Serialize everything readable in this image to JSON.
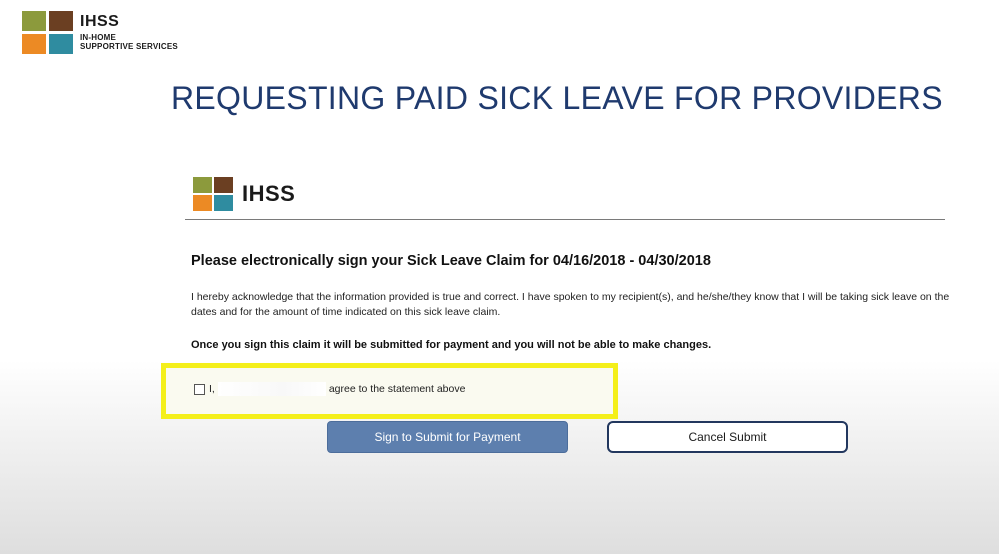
{
  "brand": {
    "name": "IHSS",
    "subtitle_line1": "IN-HOME",
    "subtitle_line2": "SUPPORTIVE SERVICES",
    "colors": [
      "#8c9a3c",
      "#6b3f22",
      "#ec8a24",
      "#2f8ca0"
    ]
  },
  "slide": {
    "title": "REQUESTING PAID SICK LEAVE FOR PROVIDERS"
  },
  "form": {
    "header_brand": "IHSS",
    "heading": "Please electronically sign your Sick Leave Claim for 04/16/2018 - 04/30/2018",
    "acknowledgement": "I hereby acknowledge that the information provided is true and correct. I have spoken to my recipient(s), and he/she/they know that I will be taking sick leave on the dates and for the amount of time indicated on this sick leave claim.",
    "warning": "Once you sign this claim it will be submitted for payment and you will not be able to make changes.",
    "agree_prefix": "I,",
    "agree_suffix": "agree to the statement above",
    "checkbox_checked": false,
    "highlight_color": "#f4ef1a"
  },
  "buttons": {
    "sign_label": "Sign to Submit for Payment",
    "cancel_label": "Cancel Submit"
  }
}
